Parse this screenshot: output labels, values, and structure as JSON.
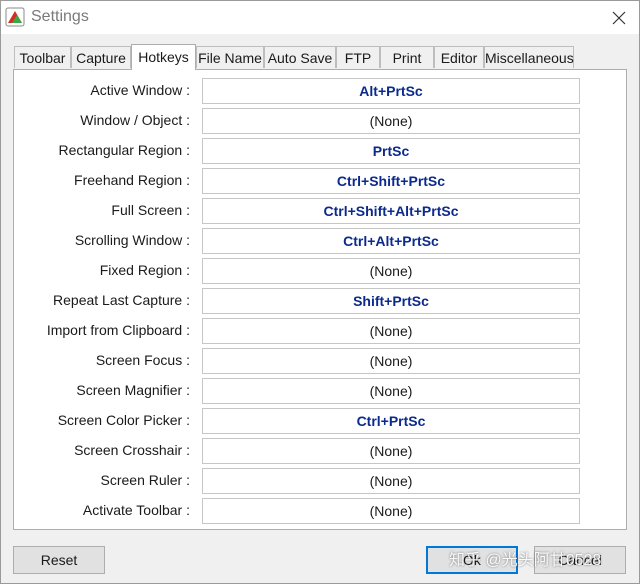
{
  "window": {
    "title": "Settings"
  },
  "tabs": [
    {
      "label": "Toolbar"
    },
    {
      "label": "Capture"
    },
    {
      "label": "Hotkeys"
    },
    {
      "label": "File Name"
    },
    {
      "label": "Auto Save"
    },
    {
      "label": "FTP"
    },
    {
      "label": "Print"
    },
    {
      "label": "Editor"
    },
    {
      "label": "Miscellaneous"
    }
  ],
  "active_tab": "Hotkeys",
  "hotkeys": [
    {
      "label": "Active Window :",
      "value": "Alt+PrtSc"
    },
    {
      "label": "Window / Object :",
      "value": "(None)"
    },
    {
      "label": "Rectangular Region :",
      "value": "PrtSc"
    },
    {
      "label": "Freehand Region :",
      "value": "Ctrl+Shift+PrtSc"
    },
    {
      "label": "Full Screen :",
      "value": "Ctrl+Shift+Alt+PrtSc"
    },
    {
      "label": "Scrolling Window :",
      "value": "Ctrl+Alt+PrtSc"
    },
    {
      "label": "Fixed Region :",
      "value": "(None)"
    },
    {
      "label": "Repeat Last Capture :",
      "value": "Shift+PrtSc"
    },
    {
      "label": "Import from Clipboard :",
      "value": "(None)"
    },
    {
      "label": "Screen Focus :",
      "value": "(None)"
    },
    {
      "label": "Screen Magnifier :",
      "value": "(None)"
    },
    {
      "label": "Screen Color Picker :",
      "value": "Ctrl+PrtSc"
    },
    {
      "label": "Screen Crosshair :",
      "value": "(None)"
    },
    {
      "label": "Screen Ruler :",
      "value": "(None)"
    },
    {
      "label": "Activate Toolbar :",
      "value": "(None)"
    }
  ],
  "buttons": {
    "reset": "Reset",
    "ok": "Ok",
    "cancel": "Cancel"
  },
  "watermark": "知乎 @光头阿甘0528",
  "colors": {
    "assigned_hotkey": "#0b2a8c",
    "default_button_border": "#0078d7",
    "window_bg": "#f0f0f0"
  },
  "icons": {
    "app": "app-logo-icon",
    "close": "close-icon"
  }
}
